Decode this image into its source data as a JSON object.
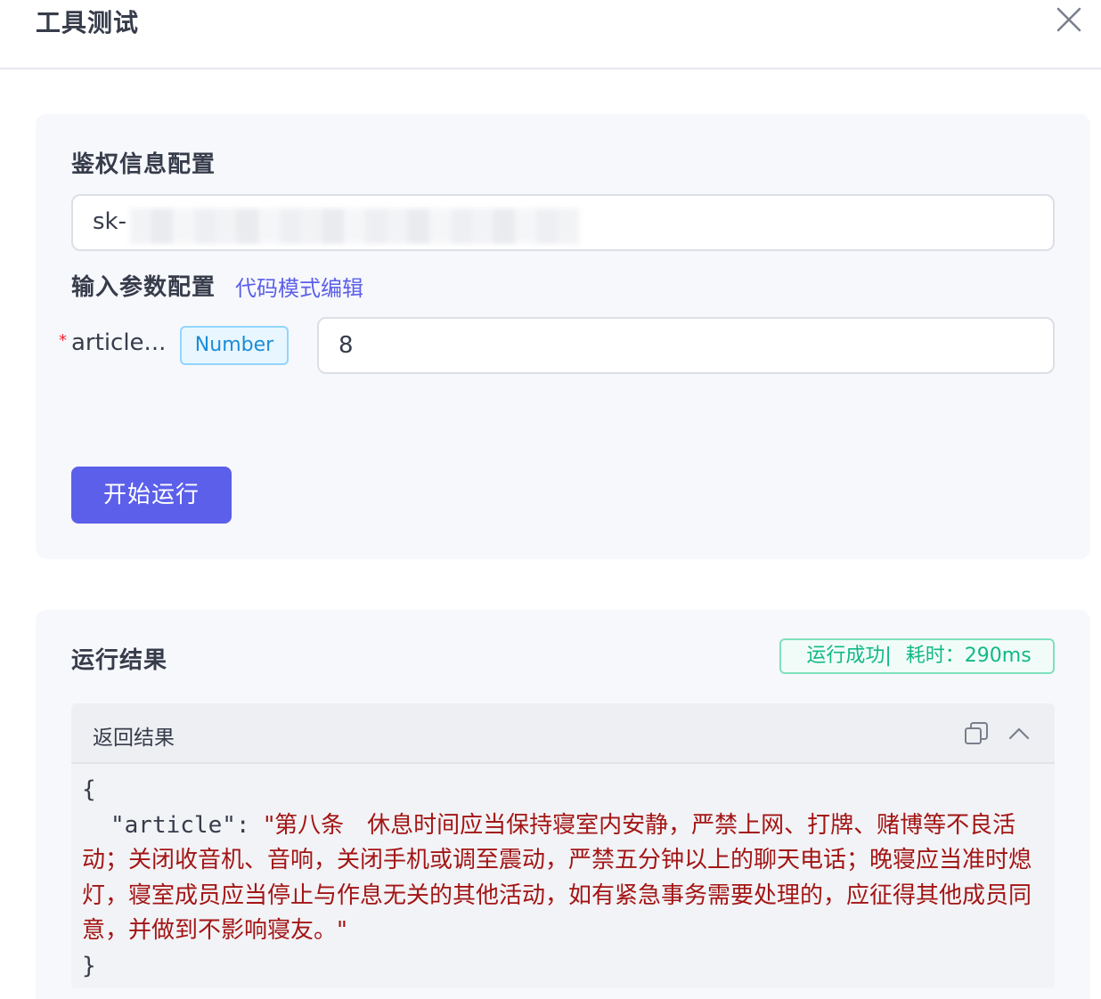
{
  "dialog": {
    "title": "工具测试"
  },
  "config": {
    "auth_label": "鉴权信息配置",
    "auth_value_prefix": "sk-",
    "params_label": "输入参数配置",
    "code_mode_link": "代码模式编辑",
    "params": [
      {
        "required_mark": "*",
        "name": "article...",
        "type": "Number",
        "value": "8"
      }
    ],
    "run_button": "开始运行"
  },
  "result": {
    "label": "运行结果",
    "status": "运行成功|",
    "duration": "耗时：290ms",
    "panel_title": "返回结果",
    "json_open": "{",
    "json_key": "\"article\"",
    "json_colon": ": ",
    "json_value": "\"第八条　休息时间应当保持寝室内安静，严禁上网、打牌、赌博等不良活动；关闭收音机、音响，关闭手机或调至震动，严禁五分钟以上的聊天电话；晚寝应当准时熄灯，寝室成员应当停止与作息无关的其他活动，如有紧急事务需要处理的，应征得其他成员同意，并做到不影响寝友。\"",
    "json_close": "}"
  },
  "colors": {
    "accent": "#5b5fe9",
    "success": "#12b886",
    "string_value": "#a31515",
    "required": "#f5222d"
  },
  "icons": {
    "close": "close-icon",
    "copy": "copy-icon",
    "collapse": "chevron-up-icon"
  }
}
